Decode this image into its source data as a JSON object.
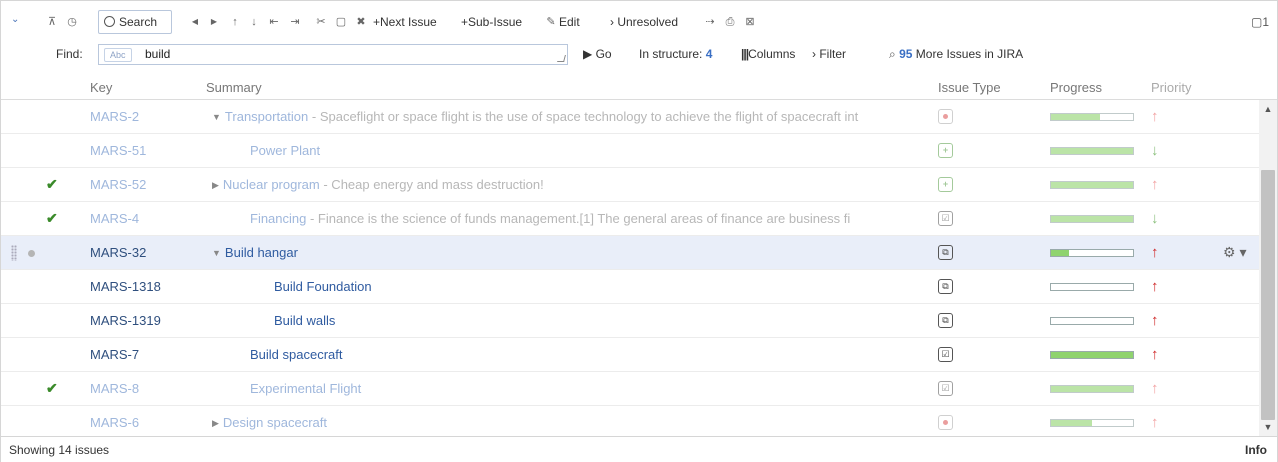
{
  "toolbar": {
    "search_label": "Search",
    "next_issue_label": "+Next Issue",
    "sub_issue_label": "+Sub-Issue",
    "edit_label": "Edit",
    "unresolved_label": "› Unresolved",
    "copy_count": "1",
    "find_label": "Find:",
    "find_chip": "Abc",
    "find_value": "build",
    "go_label": "▶ Go",
    "in_structure_label": "In structure:",
    "in_structure_count": "4",
    "columns_label": "Columns",
    "filter_label": "› Filter",
    "more_issues_count": "95",
    "more_issues_label": "More Issues in JIRA"
  },
  "columns": {
    "key": "Key",
    "summary": "Summary",
    "issue_type": "Issue Type",
    "progress": "Progress",
    "priority": "Priority"
  },
  "rows": [
    {
      "key": "MARS-2",
      "title": "Transportation",
      "desc": " - Spaceflight or space flight is the use of space technology to achieve the flight of spacecraft int",
      "indent": 0,
      "toggle": "▼",
      "check": "",
      "type": "bug",
      "progress": 0.6,
      "priority": "high",
      "state": "dim"
    },
    {
      "key": "MARS-51",
      "title": "Power Plant",
      "desc": "",
      "indent": 1,
      "toggle": "",
      "check": "",
      "type": "newfeature",
      "progress": 1.0,
      "priority": "low",
      "state": "dim"
    },
    {
      "key": "MARS-52",
      "title": "Nuclear program",
      "desc": " - Cheap energy and mass destruction!",
      "indent": 0,
      "toggle": "▶",
      "check": "✔",
      "type": "newfeature",
      "progress": 1.0,
      "priority": "high",
      "state": "dim"
    },
    {
      "key": "MARS-4",
      "title": "Financing",
      "desc": " - Finance is the science of funds management.[1] The general areas of finance are business fi",
      "indent": 1,
      "toggle": "",
      "check": "✔",
      "type": "task",
      "progress": 1.0,
      "priority": "low",
      "state": "dim"
    },
    {
      "key": "MARS-32",
      "title": "Build hangar",
      "desc": "",
      "indent": 0,
      "toggle": "▼",
      "check": "",
      "type": "sub",
      "progress": 0.22,
      "priority": "high",
      "state": "active"
    },
    {
      "key": "MARS-1318",
      "title": "Build Foundation",
      "desc": "",
      "indent": 2,
      "toggle": "",
      "check": "",
      "type": "sub",
      "progress": 0,
      "priority": "high",
      "state": "active"
    },
    {
      "key": "MARS-1319",
      "title": "Build walls",
      "desc": "",
      "indent": 2,
      "toggle": "",
      "check": "",
      "type": "sub",
      "progress": 0,
      "priority": "high",
      "state": "active"
    },
    {
      "key": "MARS-7",
      "title": "Build spacecraft",
      "desc": "",
      "indent": 1,
      "toggle": "",
      "check": "",
      "type": "task",
      "progress": 1.0,
      "priority": "high",
      "state": "active"
    },
    {
      "key": "MARS-8",
      "title": "Experimental Flight",
      "desc": "",
      "indent": 1,
      "toggle": "",
      "check": "✔",
      "type": "task",
      "progress": 1.0,
      "priority": "high",
      "state": "dim"
    },
    {
      "key": "MARS-6",
      "title": "Design spacecraft",
      "desc": "",
      "indent": 0,
      "toggle": "▶",
      "check": "",
      "type": "bug",
      "progress": 0.5,
      "priority": "high",
      "state": "dim"
    }
  ],
  "footer": {
    "status": "Showing 14 issues",
    "info": "Info"
  },
  "colors": {
    "selected_row": "#e9eef9",
    "progress_fill": "#8fd36e",
    "priority_high": "#d02b2b",
    "priority_low": "#3a8a2a",
    "link_blue": "#3a6fc4"
  }
}
